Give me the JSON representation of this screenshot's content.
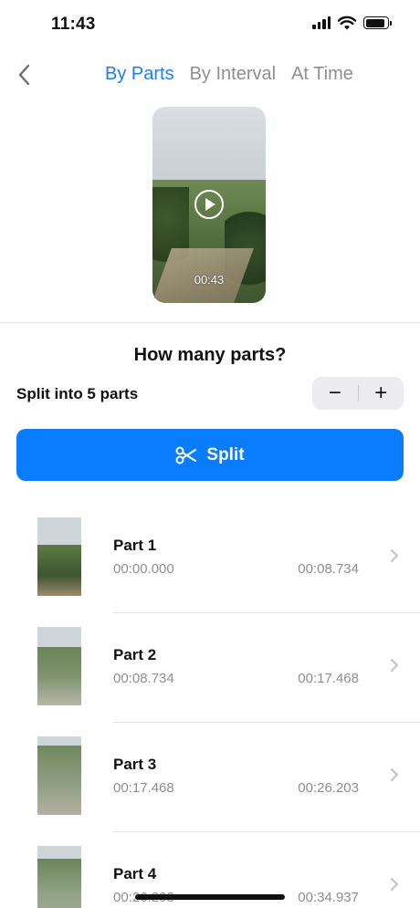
{
  "status_bar": {
    "time": "11:43"
  },
  "nav": {
    "tabs": [
      {
        "label": "By Parts",
        "active": true
      },
      {
        "label": "By Interval",
        "active": false
      },
      {
        "label": "At Time",
        "active": false
      }
    ]
  },
  "preview": {
    "duration": "00:43"
  },
  "options": {
    "question": "How many parts?",
    "split_label": "Split into 5 parts",
    "minus_label": "−",
    "plus_label": "+"
  },
  "split_button": {
    "label": "Split",
    "icon": "scissors-icon"
  },
  "parts": [
    {
      "title": "Part 1",
      "start": "00:00.000",
      "end": "00:08.734"
    },
    {
      "title": "Part 2",
      "start": "00:08.734",
      "end": "00:17.468"
    },
    {
      "title": "Part 3",
      "start": "00:17.468",
      "end": "00:26.203"
    },
    {
      "title": "Part 4",
      "start": "00:26.203",
      "end": "00:34.937"
    }
  ],
  "colors": {
    "accent": "#0a7cff",
    "tab_active": "#1a7ef3",
    "secondary_text": "#8e8e93"
  }
}
